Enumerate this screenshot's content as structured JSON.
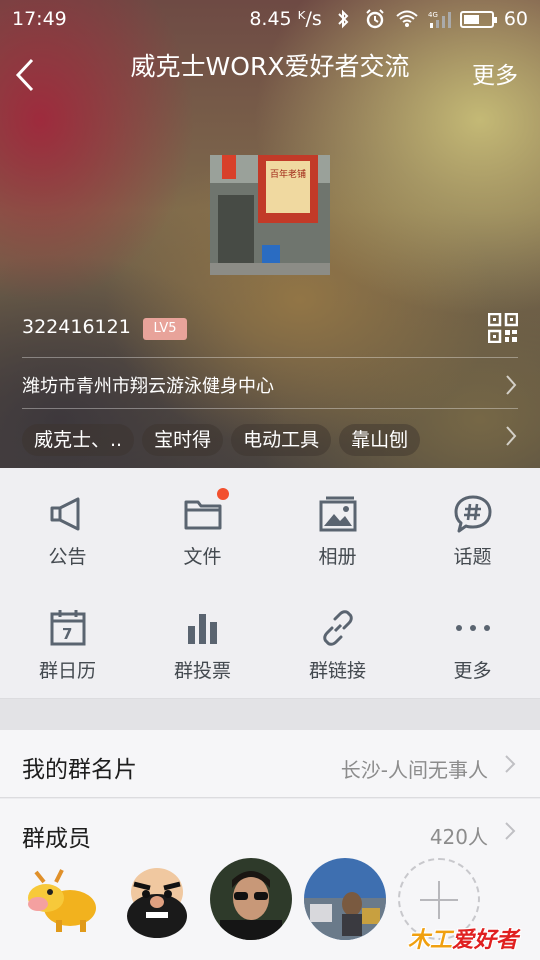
{
  "status_bar": {
    "time": "17:49",
    "network_speed": "8.45 ᴷ/s",
    "battery": "60",
    "battery_level_percent": 60
  },
  "header": {
    "back_icon": "chevron-left-icon",
    "title": "威克士WORX爱好者交流",
    "more_label": "更多",
    "group_id": "322416121",
    "level_badge": "LV5",
    "location": "潍坊市青州市翔云游泳健身中心",
    "tags": [
      "威克士、..",
      "宝时得",
      "电动工具",
      "靠山刨"
    ]
  },
  "functions": [
    {
      "label": "公告",
      "icon": "megaphone-icon"
    },
    {
      "label": "文件",
      "icon": "folder-icon",
      "has_badge": true
    },
    {
      "label": "相册",
      "icon": "photo-album-icon"
    },
    {
      "label": "话题",
      "icon": "topic-hash-icon"
    },
    {
      "label": "群日历",
      "icon": "calendar-icon"
    },
    {
      "label": "群投票",
      "icon": "bar-chart-icon"
    },
    {
      "label": "群链接",
      "icon": "link-icon"
    },
    {
      "label": "更多",
      "icon": "more-dots-icon"
    }
  ],
  "group_card": {
    "label": "我的群名片",
    "value": "长沙-人间无事人"
  },
  "group_members": {
    "label": "群成员",
    "count": "420人"
  },
  "watermark": {
    "text": "木工爱好者"
  },
  "colors": {
    "icon": "#5a6470",
    "badge": "#f2502e",
    "level_badge": "#e8a39a"
  }
}
